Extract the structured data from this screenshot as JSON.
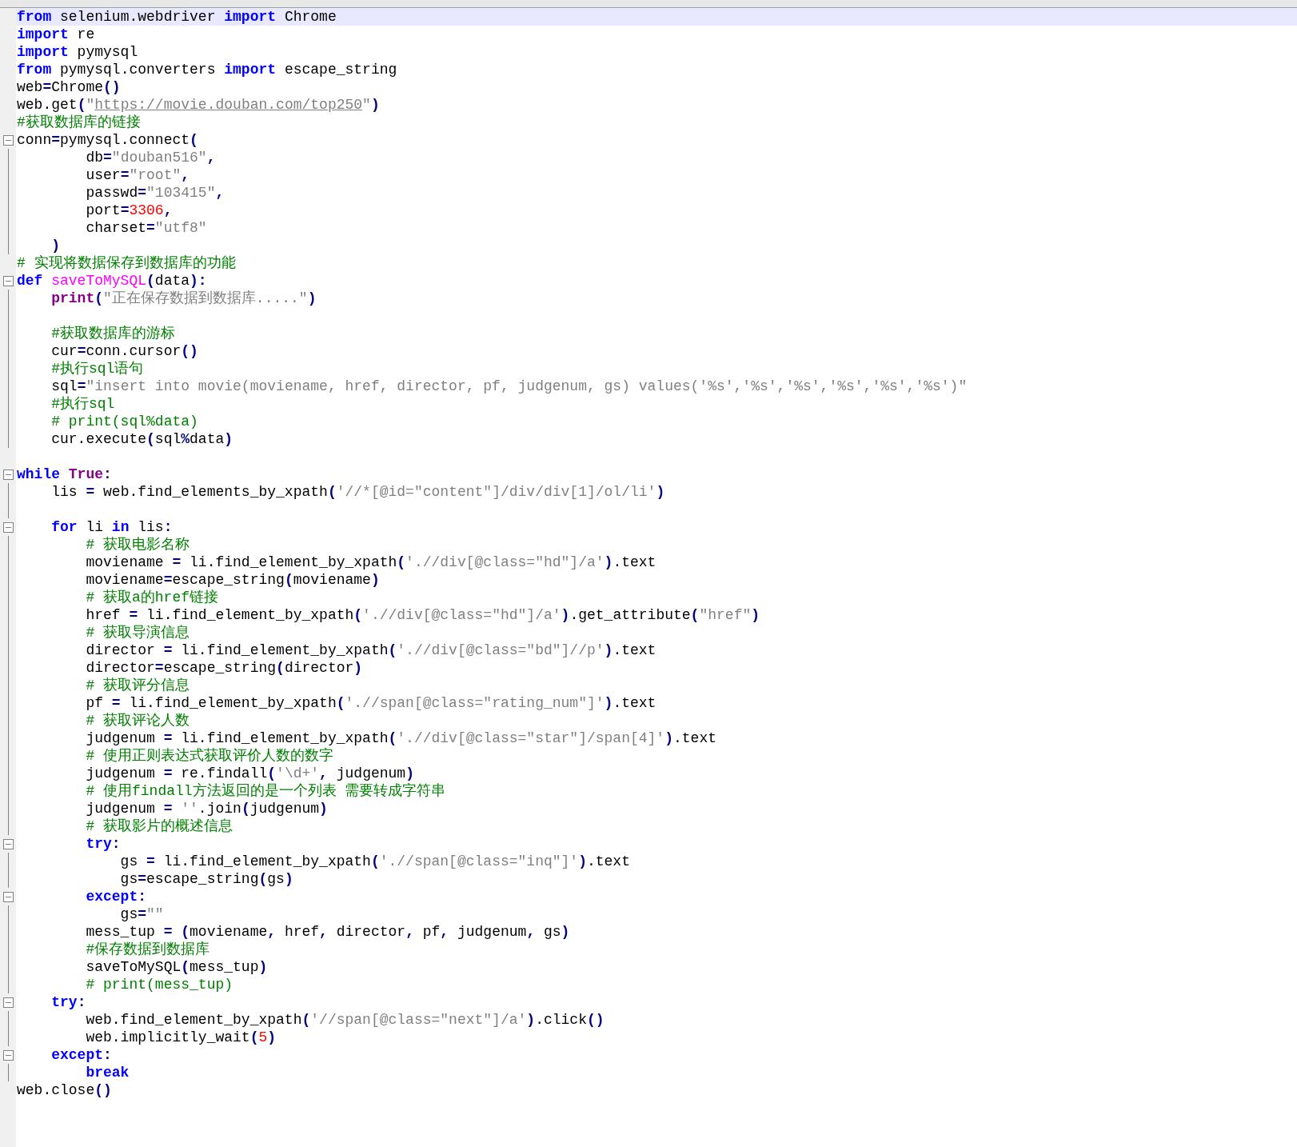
{
  "editor": {
    "lines": [
      {
        "current": true,
        "kind": "plain",
        "segments": [
          {
            "kind": "kw",
            "text": "from"
          },
          {
            "kind": "plain",
            "text": " selenium.webdriver "
          },
          {
            "kind": "kw",
            "text": "import"
          },
          {
            "kind": "plain",
            "text": " Chrome"
          }
        ]
      },
      {
        "current": false,
        "kind": "plain",
        "segments": [
          {
            "kind": "kw",
            "text": "import"
          },
          {
            "kind": "plain",
            "text": " re"
          }
        ]
      },
      {
        "current": false,
        "kind": "plain",
        "segments": [
          {
            "kind": "kw",
            "text": "import"
          },
          {
            "kind": "plain",
            "text": " pymysql"
          }
        ]
      },
      {
        "current": false,
        "kind": "plain",
        "segments": [
          {
            "kind": "kw",
            "text": "from"
          },
          {
            "kind": "plain",
            "text": " pymysql.converters "
          },
          {
            "kind": "kw",
            "text": "import"
          },
          {
            "kind": "plain",
            "text": " escape_string"
          }
        ]
      },
      {
        "current": false,
        "kind": "plain",
        "segments": [
          {
            "kind": "plain",
            "text": "web"
          },
          {
            "kind": "op",
            "text": "="
          },
          {
            "kind": "plain",
            "text": "Chrome"
          },
          {
            "kind": "op",
            "text": "()"
          }
        ]
      },
      {
        "current": false,
        "kind": "plain",
        "segments": [
          {
            "kind": "plain",
            "text": "web.get"
          },
          {
            "kind": "op",
            "text": "("
          },
          {
            "kind": "str",
            "text": "\""
          },
          {
            "kind": "link",
            "text": "https://movie.douban.com/top250"
          },
          {
            "kind": "str",
            "text": "\""
          },
          {
            "kind": "op",
            "text": ")"
          }
        ]
      },
      {
        "current": false,
        "kind": "plain",
        "segments": [
          {
            "kind": "comment",
            "text": "#获取数据库的链接"
          }
        ]
      },
      {
        "current": false,
        "kind": "block_start",
        "segments": [
          {
            "kind": "plain",
            "text": "conn"
          },
          {
            "kind": "op",
            "text": "="
          },
          {
            "kind": "plain",
            "text": "pymysql.connect"
          },
          {
            "kind": "op",
            "text": "("
          }
        ]
      },
      {
        "current": false,
        "kind": "plain",
        "segments": [
          {
            "kind": "plain",
            "text": "        db"
          },
          {
            "kind": "op",
            "text": "="
          },
          {
            "kind": "str",
            "text": "\"douban516\""
          },
          {
            "kind": "op",
            "text": ","
          }
        ]
      },
      {
        "current": false,
        "kind": "plain",
        "segments": [
          {
            "kind": "plain",
            "text": "        user"
          },
          {
            "kind": "op",
            "text": "="
          },
          {
            "kind": "str",
            "text": "\"root\""
          },
          {
            "kind": "op",
            "text": ","
          }
        ]
      },
      {
        "current": false,
        "kind": "plain",
        "segments": [
          {
            "kind": "plain",
            "text": "        passwd"
          },
          {
            "kind": "op",
            "text": "="
          },
          {
            "kind": "str",
            "text": "\"103415\""
          },
          {
            "kind": "op",
            "text": ","
          }
        ]
      },
      {
        "current": false,
        "kind": "plain",
        "segments": [
          {
            "kind": "plain",
            "text": "        port"
          },
          {
            "kind": "op",
            "text": "="
          },
          {
            "kind": "num",
            "text": "3306"
          },
          {
            "kind": "op",
            "text": ","
          }
        ]
      },
      {
        "current": false,
        "kind": "plain",
        "segments": [
          {
            "kind": "plain",
            "text": "        charset"
          },
          {
            "kind": "op",
            "text": "="
          },
          {
            "kind": "str",
            "text": "\"utf8\""
          }
        ]
      },
      {
        "current": false,
        "kind": "plain",
        "segments": [
          {
            "kind": "op",
            "text": "    )"
          }
        ]
      },
      {
        "current": false,
        "kind": "plain",
        "segments": [
          {
            "kind": "comment",
            "text": "# 实现将数据保存到数据库的功能"
          }
        ]
      },
      {
        "current": false,
        "kind": "block_start",
        "segments": [
          {
            "kind": "kw",
            "text": "def"
          },
          {
            "kind": "func",
            "text": " saveToMySQL"
          },
          {
            "kind": "op",
            "text": "("
          },
          {
            "kind": "plain",
            "text": "data"
          },
          {
            "kind": "op",
            "text": "):"
          }
        ]
      },
      {
        "current": false,
        "kind": "plain",
        "segments": [
          {
            "kind": "builtin",
            "text": "    print"
          },
          {
            "kind": "op",
            "text": "("
          },
          {
            "kind": "str",
            "text": "\"正在保存数据到数据库.....\""
          },
          {
            "kind": "op",
            "text": ")"
          }
        ]
      },
      {
        "current": false,
        "kind": "plain"
      },
      {
        "current": false,
        "kind": "plain",
        "segments": [
          {
            "kind": "comment",
            "text": "    #获取数据库的游标"
          }
        ]
      },
      {
        "current": false,
        "kind": "plain",
        "segments": [
          {
            "kind": "plain",
            "text": "    cur"
          },
          {
            "kind": "op",
            "text": "="
          },
          {
            "kind": "plain",
            "text": "conn.cursor"
          },
          {
            "kind": "op",
            "text": "()"
          }
        ]
      },
      {
        "current": false,
        "kind": "plain",
        "segments": [
          {
            "kind": "comment",
            "text": "    #执行sql语句"
          }
        ]
      },
      {
        "current": false,
        "kind": "plain",
        "segments": [
          {
            "kind": "plain",
            "text": "    sql"
          },
          {
            "kind": "op",
            "text": "="
          },
          {
            "kind": "str",
            "text": "\"insert into movie(moviename, href, director, pf, judgenum, gs) values('%s','%s','%s','%s','%s','%s')\""
          }
        ]
      },
      {
        "current": false,
        "kind": "plain",
        "segments": [
          {
            "kind": "comment",
            "text": "    #执行sql"
          }
        ]
      },
      {
        "current": false,
        "kind": "plain",
        "segments": [
          {
            "kind": "comment",
            "text": "    # print(sql%data)"
          }
        ]
      },
      {
        "current": false,
        "kind": "plain",
        "segments": [
          {
            "kind": "plain",
            "text": "    cur.execute"
          },
          {
            "kind": "op",
            "text": "("
          },
          {
            "kind": "plain",
            "text": "sql"
          },
          {
            "kind": "op",
            "text": "%"
          },
          {
            "kind": "plain",
            "text": "data"
          },
          {
            "kind": "op",
            "text": ")"
          }
        ]
      },
      {
        "current": false,
        "kind": "plain"
      },
      {
        "current": false,
        "kind": "block_start",
        "segments": [
          {
            "kind": "kw",
            "text": "while"
          },
          {
            "kind": "builtin",
            "text": " True"
          },
          {
            "kind": "op",
            "text": ":"
          }
        ]
      },
      {
        "current": false,
        "kind": "plain",
        "segments": [
          {
            "kind": "plain",
            "text": "    lis "
          },
          {
            "kind": "op",
            "text": "="
          },
          {
            "kind": "plain",
            "text": " web.find_elements_by_xpath"
          },
          {
            "kind": "op",
            "text": "("
          },
          {
            "kind": "str",
            "text": "'//*[@id=\"content\"]/div/div[1]/ol/li'"
          },
          {
            "kind": "op",
            "text": ")"
          }
        ]
      },
      {
        "current": false,
        "kind": "plain"
      },
      {
        "current": false,
        "kind": "block_start",
        "segments": [
          {
            "kind": "kw",
            "text": "    for"
          },
          {
            "kind": "plain",
            "text": " li "
          },
          {
            "kind": "kw",
            "text": "in"
          },
          {
            "kind": "plain",
            "text": " lis"
          },
          {
            "kind": "op",
            "text": ":"
          }
        ]
      },
      {
        "current": false,
        "kind": "plain",
        "segments": [
          {
            "kind": "comment",
            "text": "        # 获取电影名称"
          }
        ]
      },
      {
        "current": false,
        "kind": "plain",
        "segments": [
          {
            "kind": "plain",
            "text": "        moviename "
          },
          {
            "kind": "op",
            "text": "="
          },
          {
            "kind": "plain",
            "text": " li.find_element_by_xpath"
          },
          {
            "kind": "op",
            "text": "("
          },
          {
            "kind": "str",
            "text": "'.//div[@class=\"hd\"]/a'"
          },
          {
            "kind": "op",
            "text": ")"
          },
          {
            "kind": "plain",
            "text": ".text"
          }
        ]
      },
      {
        "current": false,
        "kind": "plain",
        "segments": [
          {
            "kind": "plain",
            "text": "        moviename"
          },
          {
            "kind": "op",
            "text": "="
          },
          {
            "kind": "plain",
            "text": "escape_string"
          },
          {
            "kind": "op",
            "text": "("
          },
          {
            "kind": "plain",
            "text": "moviename"
          },
          {
            "kind": "op",
            "text": ")"
          }
        ]
      },
      {
        "current": false,
        "kind": "plain",
        "segments": [
          {
            "kind": "comment",
            "text": "        # 获取a的href链接"
          }
        ]
      },
      {
        "current": false,
        "kind": "plain",
        "segments": [
          {
            "kind": "plain",
            "text": "        href "
          },
          {
            "kind": "op",
            "text": "="
          },
          {
            "kind": "plain",
            "text": " li.find_element_by_xpath"
          },
          {
            "kind": "op",
            "text": "("
          },
          {
            "kind": "str",
            "text": "'.//div[@class=\"hd\"]/a'"
          },
          {
            "kind": "op",
            "text": ")"
          },
          {
            "kind": "plain",
            "text": ".get_attribute"
          },
          {
            "kind": "op",
            "text": "("
          },
          {
            "kind": "str",
            "text": "\"href\""
          },
          {
            "kind": "op",
            "text": ")"
          }
        ]
      },
      {
        "current": false,
        "kind": "plain",
        "segments": [
          {
            "kind": "comment",
            "text": "        # 获取导演信息"
          }
        ]
      },
      {
        "current": false,
        "kind": "plain",
        "segments": [
          {
            "kind": "plain",
            "text": "        director "
          },
          {
            "kind": "op",
            "text": "="
          },
          {
            "kind": "plain",
            "text": " li.find_element_by_xpath"
          },
          {
            "kind": "op",
            "text": "("
          },
          {
            "kind": "str",
            "text": "'.//div[@class=\"bd\"]//p'"
          },
          {
            "kind": "op",
            "text": ")"
          },
          {
            "kind": "plain",
            "text": ".text"
          }
        ]
      },
      {
        "current": false,
        "kind": "plain",
        "segments": [
          {
            "kind": "plain",
            "text": "        director"
          },
          {
            "kind": "op",
            "text": "="
          },
          {
            "kind": "plain",
            "text": "escape_string"
          },
          {
            "kind": "op",
            "text": "("
          },
          {
            "kind": "plain",
            "text": "director"
          },
          {
            "kind": "op",
            "text": ")"
          }
        ]
      },
      {
        "current": false,
        "kind": "plain",
        "segments": [
          {
            "kind": "comment",
            "text": "        # 获取评分信息"
          }
        ]
      },
      {
        "current": false,
        "kind": "plain",
        "segments": [
          {
            "kind": "plain",
            "text": "        pf "
          },
          {
            "kind": "op",
            "text": "="
          },
          {
            "kind": "plain",
            "text": " li.find_element_by_xpath"
          },
          {
            "kind": "op",
            "text": "("
          },
          {
            "kind": "str",
            "text": "'.//span[@class=\"rating_num\"]'"
          },
          {
            "kind": "op",
            "text": ")"
          },
          {
            "kind": "plain",
            "text": ".text"
          }
        ]
      },
      {
        "current": false,
        "kind": "plain",
        "segments": [
          {
            "kind": "comment",
            "text": "        # 获取评论人数"
          }
        ]
      },
      {
        "current": false,
        "kind": "plain",
        "segments": [
          {
            "kind": "plain",
            "text": "        judgenum "
          },
          {
            "kind": "op",
            "text": "="
          },
          {
            "kind": "plain",
            "text": " li.find_element_by_xpath"
          },
          {
            "kind": "op",
            "text": "("
          },
          {
            "kind": "str",
            "text": "'.//div[@class=\"star\"]/span[4]'"
          },
          {
            "kind": "op",
            "text": ")"
          },
          {
            "kind": "plain",
            "text": ".text"
          }
        ]
      },
      {
        "current": false,
        "kind": "plain",
        "segments": [
          {
            "kind": "comment",
            "text": "        # 使用正则表达式获取评价人数的数字"
          }
        ]
      },
      {
        "current": false,
        "kind": "plain",
        "segments": [
          {
            "kind": "plain",
            "text": "        judgenum "
          },
          {
            "kind": "op",
            "text": "="
          },
          {
            "kind": "plain",
            "text": " re.findall"
          },
          {
            "kind": "op",
            "text": "("
          },
          {
            "kind": "str",
            "text": "'\\d+'"
          },
          {
            "kind": "op",
            "text": ","
          },
          {
            "kind": "plain",
            "text": " judgenum"
          },
          {
            "kind": "op",
            "text": ")"
          }
        ]
      },
      {
        "current": false,
        "kind": "plain",
        "segments": [
          {
            "kind": "comment",
            "text": "        # 使用findall方法返回的是一个列表 需要转成字符串"
          }
        ]
      },
      {
        "current": false,
        "kind": "plain",
        "segments": [
          {
            "kind": "plain",
            "text": "        judgenum "
          },
          {
            "kind": "op",
            "text": "="
          },
          {
            "kind": "str",
            "text": " ''"
          },
          {
            "kind": "plain",
            "text": ".join"
          },
          {
            "kind": "op",
            "text": "("
          },
          {
            "kind": "plain",
            "text": "judgenum"
          },
          {
            "kind": "op",
            "text": ")"
          }
        ]
      },
      {
        "current": false,
        "kind": "plain",
        "segments": [
          {
            "kind": "comment",
            "text": "        # 获取影片的概述信息"
          }
        ]
      },
      {
        "current": false,
        "kind": "block_start",
        "segments": [
          {
            "kind": "kw",
            "text": "        try"
          },
          {
            "kind": "op",
            "text": ":"
          }
        ]
      },
      {
        "current": false,
        "kind": "plain",
        "segments": [
          {
            "kind": "plain",
            "text": "            gs "
          },
          {
            "kind": "op",
            "text": "="
          },
          {
            "kind": "plain",
            "text": " li.find_element_by_xpath"
          },
          {
            "kind": "op",
            "text": "("
          },
          {
            "kind": "str",
            "text": "'.//span[@class=\"inq\"]'"
          },
          {
            "kind": "op",
            "text": ")"
          },
          {
            "kind": "plain",
            "text": ".text"
          }
        ]
      },
      {
        "current": false,
        "kind": "plain",
        "segments": [
          {
            "kind": "plain",
            "text": "            gs"
          },
          {
            "kind": "op",
            "text": "="
          },
          {
            "kind": "plain",
            "text": "escape_string"
          },
          {
            "kind": "op",
            "text": "("
          },
          {
            "kind": "plain",
            "text": "gs"
          },
          {
            "kind": "op",
            "text": ")"
          }
        ]
      },
      {
        "current": false,
        "kind": "block_start",
        "segments": [
          {
            "kind": "kw",
            "text": "        except"
          },
          {
            "kind": "op",
            "text": ":"
          }
        ]
      },
      {
        "current": false,
        "kind": "plain",
        "segments": [
          {
            "kind": "plain",
            "text": "            gs"
          },
          {
            "kind": "op",
            "text": "="
          },
          {
            "kind": "str",
            "text": "\"\""
          }
        ]
      },
      {
        "current": false,
        "kind": "plain",
        "segments": [
          {
            "kind": "plain",
            "text": "        mess_tup "
          },
          {
            "kind": "op",
            "text": "= ("
          },
          {
            "kind": "plain",
            "text": "moviename"
          },
          {
            "kind": "op",
            "text": ","
          },
          {
            "kind": "plain",
            "text": " href"
          },
          {
            "kind": "op",
            "text": ","
          },
          {
            "kind": "plain",
            "text": " director"
          },
          {
            "kind": "op",
            "text": ","
          },
          {
            "kind": "plain",
            "text": " pf"
          },
          {
            "kind": "op",
            "text": ","
          },
          {
            "kind": "plain",
            "text": " judgenum"
          },
          {
            "kind": "op",
            "text": ","
          },
          {
            "kind": "plain",
            "text": " gs"
          },
          {
            "kind": "op",
            "text": ")"
          }
        ]
      },
      {
        "current": false,
        "kind": "plain",
        "segments": [
          {
            "kind": "comment",
            "text": "        #保存数据到数据库"
          }
        ]
      },
      {
        "current": false,
        "kind": "plain",
        "segments": [
          {
            "kind": "plain",
            "text": "        saveToMySQL"
          },
          {
            "kind": "op",
            "text": "("
          },
          {
            "kind": "plain",
            "text": "mess_tup"
          },
          {
            "kind": "op",
            "text": ")"
          }
        ]
      },
      {
        "current": false,
        "kind": "plain",
        "segments": [
          {
            "kind": "comment",
            "text": "        # print(mess_tup)"
          }
        ]
      },
      {
        "current": false,
        "kind": "block_start",
        "segments": [
          {
            "kind": "kw",
            "text": "    try"
          },
          {
            "kind": "op",
            "text": ":"
          }
        ]
      },
      {
        "current": false,
        "kind": "plain",
        "segments": [
          {
            "kind": "plain",
            "text": "        web.find_element_by_xpath"
          },
          {
            "kind": "op",
            "text": "("
          },
          {
            "kind": "str",
            "text": "'//span[@class=\"next\"]/a'"
          },
          {
            "kind": "op",
            "text": ")"
          },
          {
            "kind": "plain",
            "text": ".click"
          },
          {
            "kind": "op",
            "text": "()"
          }
        ]
      },
      {
        "current": false,
        "kind": "plain",
        "segments": [
          {
            "kind": "plain",
            "text": "        web.implicitly_wait"
          },
          {
            "kind": "op",
            "text": "("
          },
          {
            "kind": "num",
            "text": "5"
          },
          {
            "kind": "op",
            "text": ")"
          }
        ]
      },
      {
        "current": false,
        "kind": "block_start",
        "segments": [
          {
            "kind": "kw",
            "text": "    except"
          },
          {
            "kind": "op",
            "text": ":"
          }
        ]
      },
      {
        "current": false,
        "kind": "plain",
        "segments": [
          {
            "kind": "kw",
            "text": "        break"
          }
        ]
      },
      {
        "current": false,
        "kind": "plain",
        "segments": [
          {
            "kind": "plain",
            "text": "web.close"
          },
          {
            "kind": "op",
            "text": "()"
          }
        ]
      }
    ]
  }
}
